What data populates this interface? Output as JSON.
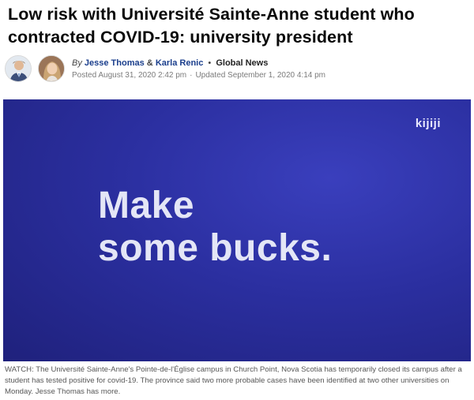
{
  "article": {
    "headline": "Low risk with Université Sainte-Anne student who contracted COVID-19: university president",
    "byline": {
      "by": "By",
      "author1": "Jesse Thomas",
      "amp": "&",
      "author2": "Karla Renic",
      "dot": "•",
      "outlet": "Global News",
      "posted": "Posted August 31, 2020 2:42 pm",
      "separator": "·",
      "updated": "Updated September 1, 2020 4:14 pm"
    }
  },
  "video": {
    "brand_logo": "kijiji",
    "slogan_line1": "Make",
    "slogan_line2": "some bucks.",
    "background_color": "#2b2fa0"
  },
  "caption": "WATCH: The Université Sainte-Anne's Pointe-de-l'Église campus in Church Point, Nova Scotia has temporarily closed its campus after a student has tested positive for covid-19. The province said two more probable cases have been identified at two other universities on Monday. Jesse Thomas has more."
}
